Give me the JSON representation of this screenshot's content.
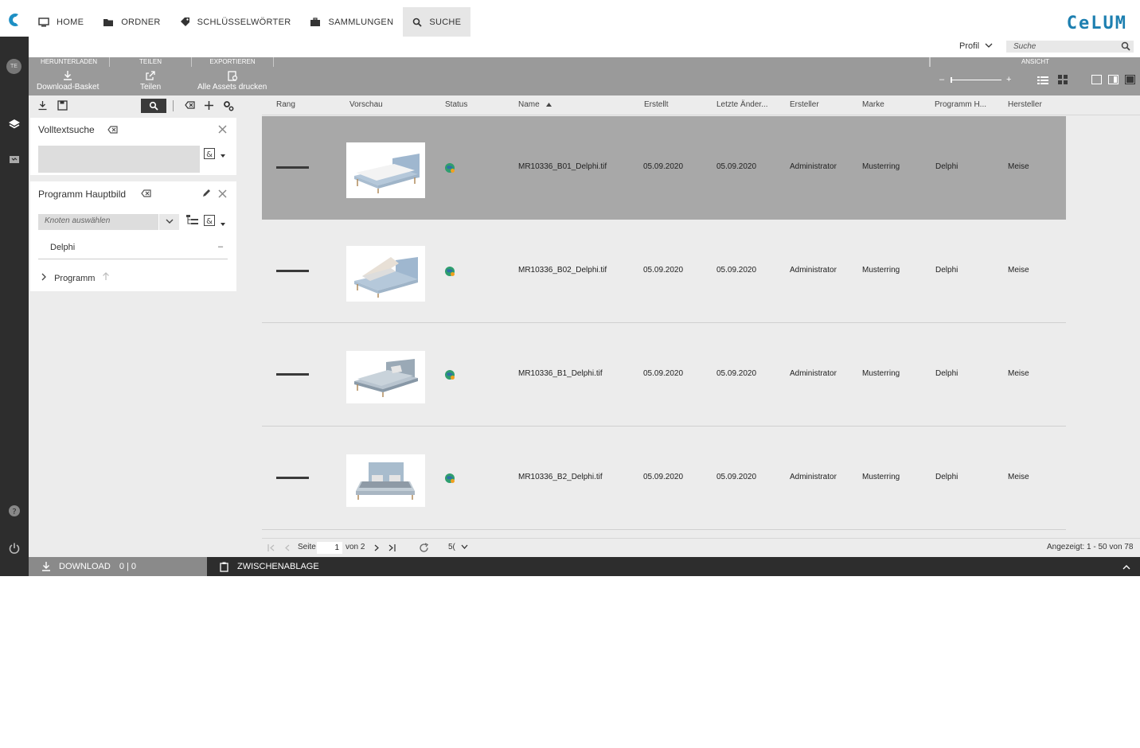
{
  "nav": {
    "items": [
      {
        "label": "HOME",
        "icon": "monitor-icon"
      },
      {
        "label": "ORDNER",
        "icon": "folder-icon"
      },
      {
        "label": "SCHLÜSSELWÖRTER",
        "icon": "tag-icon"
      },
      {
        "label": "SAMMLUNGEN",
        "icon": "briefcase-icon"
      },
      {
        "label": "SUCHE",
        "icon": "search-icon",
        "active": true
      }
    ],
    "brand": "CeLUM"
  },
  "rail": {
    "avatar": "TE"
  },
  "header": {
    "profile_label": "Profil",
    "search_placeholder": "Suche"
  },
  "actions": {
    "groups": [
      "HERUNTERLADEN",
      "TEILEN",
      "EXPORTIEREN",
      "ANSICHT"
    ],
    "buttons": [
      "Download-Basket",
      "Teilen",
      "Alle Assets drucken"
    ],
    "zoom_minus": "–",
    "zoom_plus": "+"
  },
  "filters": {
    "fulltext": {
      "title": "Volltextsuche"
    },
    "program": {
      "title": "Programm Hauptbild",
      "select_placeholder": "Knoten auswählen",
      "selected_tag": "Delphi",
      "remove_glyph": "–",
      "tree_item": "Programm"
    }
  },
  "table": {
    "columns": [
      "Rang",
      "Vorschau",
      "Status",
      "Name",
      "Erstellt",
      "Letzte Änder...",
      "Ersteller",
      "Marke",
      "Programm H...",
      "Hersteller"
    ],
    "rows": [
      {
        "name": "MR10336_B01_Delphi.tif",
        "created": "05.09.2020",
        "modified": "05.09.2020",
        "creator": "Administrator",
        "brand": "Musterring",
        "program": "Delphi",
        "maker": "Meise",
        "selected": true
      },
      {
        "name": "MR10336_B02_Delphi.tif",
        "created": "05.09.2020",
        "modified": "05.09.2020",
        "creator": "Administrator",
        "brand": "Musterring",
        "program": "Delphi",
        "maker": "Meise",
        "selected": false
      },
      {
        "name": "MR10336_B1_Delphi.tif",
        "created": "05.09.2020",
        "modified": "05.09.2020",
        "creator": "Administrator",
        "brand": "Musterring",
        "program": "Delphi",
        "maker": "Meise",
        "selected": false
      },
      {
        "name": "MR10336_B2_Delphi.tif",
        "created": "05.09.2020",
        "modified": "05.09.2020",
        "creator": "Administrator",
        "brand": "Musterring",
        "program": "Delphi",
        "maker": "Meise",
        "selected": false
      }
    ]
  },
  "pager": {
    "page_label": "Seite",
    "page_value": "1",
    "of_label": "von 2",
    "page_size": "5(",
    "summary": "Angezeigt: 1 - 50 von 78"
  },
  "bottom": {
    "download_label": "DOWNLOAD",
    "download_count": "0 | 0",
    "clipboard_label": "ZWISCHENABLAGE"
  }
}
